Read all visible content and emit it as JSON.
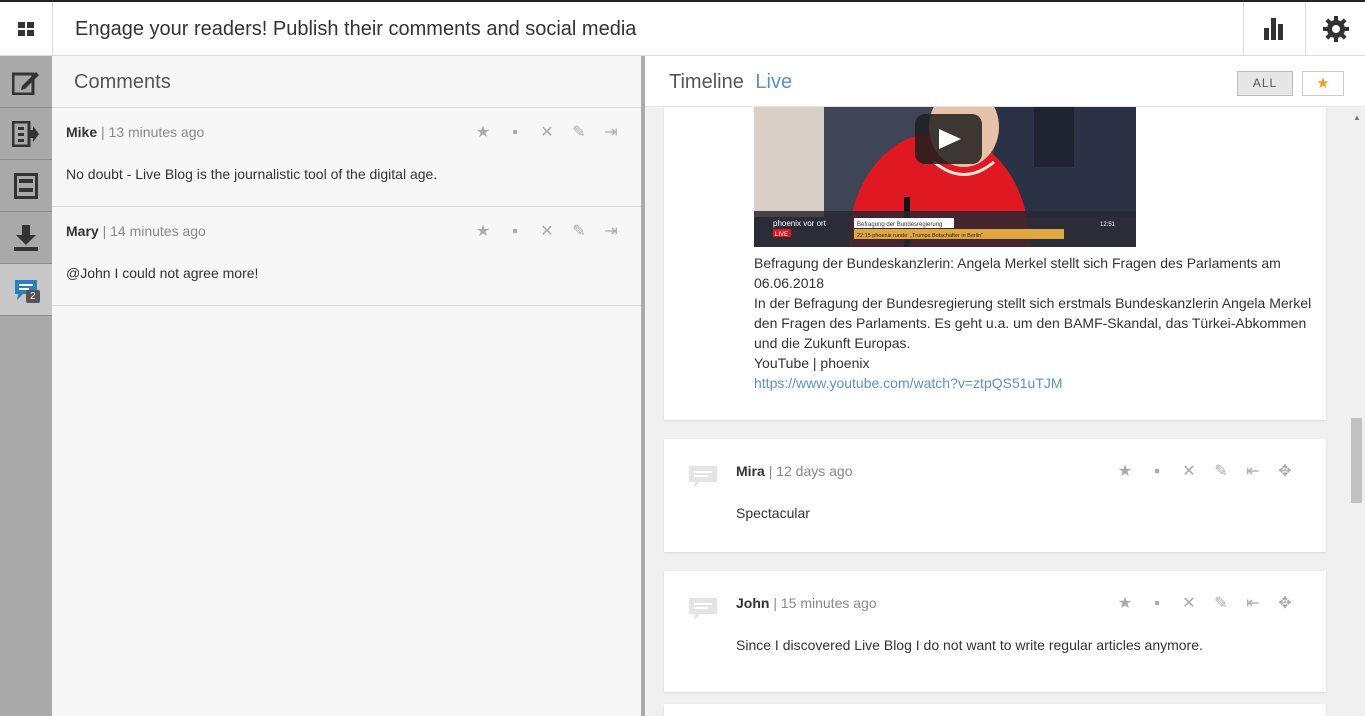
{
  "topbar": {
    "title": "Engage your readers! Publish their comments and social media",
    "menu_icon": "grid-icon",
    "stats_icon": "bar-chart-icon",
    "settings_icon": "gear-icon"
  },
  "sidebar": {
    "items": [
      {
        "name": "editor",
        "icon": "edit-icon"
      },
      {
        "name": "ingest",
        "icon": "ingest-icon"
      },
      {
        "name": "archive",
        "icon": "archive-icon"
      },
      {
        "name": "download",
        "icon": "download-icon"
      },
      {
        "name": "comments",
        "icon": "comments-icon",
        "badge": "2"
      }
    ]
  },
  "comments": {
    "header": "Comments",
    "items": [
      {
        "author": "Mike",
        "time": "13 minutes ago",
        "body": "No doubt - Live Blog is the journalistic tool of the digital age."
      },
      {
        "author": "Mary",
        "time": "14 minutes ago",
        "body": "@John I could not agree more!"
      }
    ]
  },
  "timeline": {
    "header": "Timeline",
    "live": "Live",
    "filter_all": "ALL",
    "filter_star": "★",
    "video_post": {
      "title": "Befragung der Bundeskanzlerin: Angela Merkel stellt sich Fragen des Parlaments am 06.06.2018",
      "description": "In der Befragung der Bundesregierung stellt sich erstmals Bundeskanzlerin Angela Merkel den Fragen des Parlaments. Es geht u.a. um den BAMF-Skandal, das Türkei-Abkommen und die Zukunft Europas.",
      "source": "YouTube | phoenix",
      "url": "https://www.youtube.com/watch?v=ztpQS51uTJM",
      "thumb_channel": "phoenix vor ort",
      "thumb_live": "LIVE",
      "thumb_caption": "Befragung der Bundesregierung",
      "thumb_ticker": "22:15  phoenix runde: „Trumps Botschafter in Berlin“",
      "thumb_time": "12:51"
    },
    "posts": [
      {
        "author": "Mira",
        "time": "12 days ago",
        "body": "Spectacular"
      },
      {
        "author": "John",
        "time": "15 minutes ago",
        "body": "Since I discovered Live Blog I do not want to write regular articles anymore."
      }
    ]
  },
  "colors": {
    "accent": "#5a93c0",
    "star": "#f0a020",
    "sidebar_bg": "#a9a9a9"
  }
}
